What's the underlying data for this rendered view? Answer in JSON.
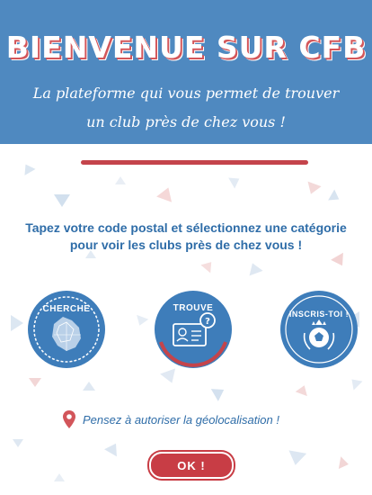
{
  "header": {
    "title": "BIENVENUE SUR CFB",
    "subtitle": "La plateforme qui vous permet de trouver un club près de chez vous !"
  },
  "main": {
    "instruction": "Tapez votre code postal et sélectionnez une catégorie pour voir les clubs près de chez vous !",
    "steps": [
      {
        "label": "CHERCHE",
        "icon": "map-icon"
      },
      {
        "label": "TROUVE",
        "icon": "id-card-icon"
      },
      {
        "label": "INSCRIS-TOI !",
        "icon": "soccer-ball-icon"
      }
    ],
    "geolocation_hint": "Pensez à autoriser la géolocalisation !",
    "ok_label": "OK !"
  },
  "colors": {
    "header_blue": "#4f89c0",
    "accent_red": "#c4444b",
    "text_blue": "#2f6da8",
    "circle_blue": "#3e7dba"
  }
}
